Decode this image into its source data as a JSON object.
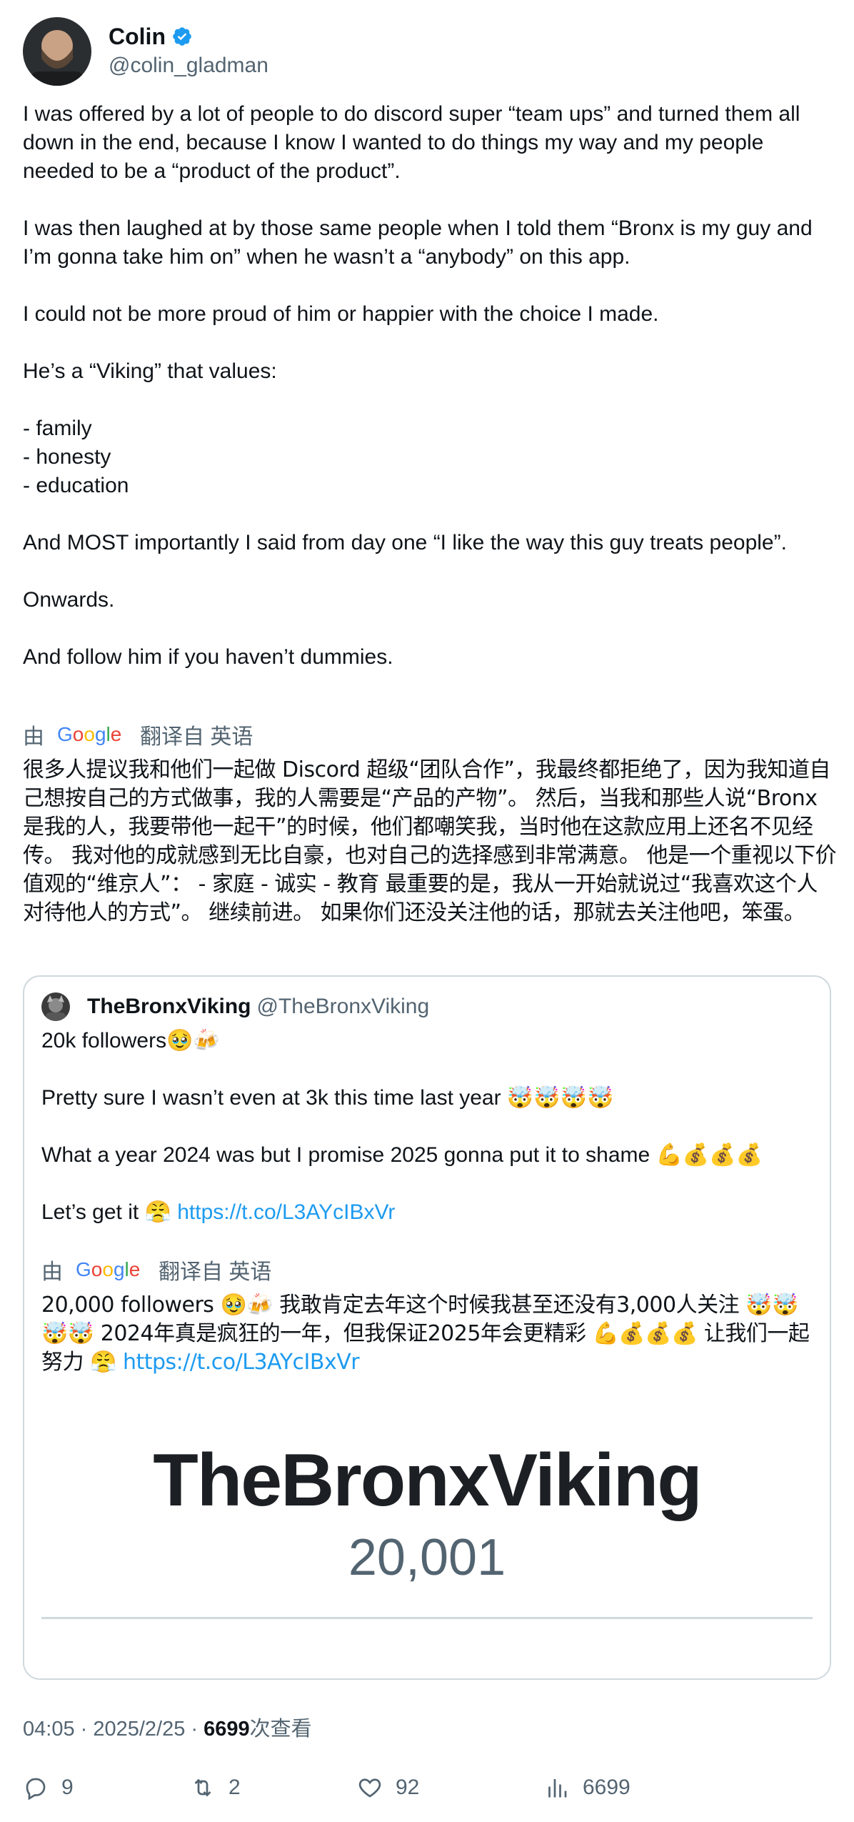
{
  "author": {
    "name": "Colin",
    "handle": "@colin_gladman"
  },
  "tweet": {
    "text": "I was offered by a lot of people to do discord super “team ups” and turned them all down in the end, because I know I wanted to do things my way and my people needed to be a “product of the product”.\n\nI was then laughed at by those same people when I told them “Bronx is my guy and I’m gonna take him on” when he wasn’t a “anybody” on this app.\n\nI could not be more proud of him or happier with the choice I made.\n\nHe’s a “Viking” that values:\n\n- family\n- honesty\n- education\n\nAnd MOST importantly I said from day one “I like the way this guy treats people”.\n\nOnwards.\n\nAnd follow him if you haven’t dummies.",
    "translation_prefix": "由",
    "translation_suffix": "翻译自 英语",
    "translated_text": "很多人提议我和他们一起做 Discord 超级“团队合作”，我最终都拒绝了，因为我知道自己想按自己的方式做事，我的人需要是“产品的产物”。 然后，当我和那些人说“Bronx 是我的人，我要带他一起干”的时候，他们都嘲笑我，当时他在这款应用上还名不见经传。 我对他的成就感到无比自豪，也对自己的选择感到非常满意。 他是一个重视以下价值观的“维京人”： - 家庭 - 诚实 - 教育 最重要的是，我从一开始就说过“我喜欢这个人对待他人的方式”。 继续前进。 如果你们还没关注他的话，那就去关注他吧，笨蛋。"
  },
  "quote": {
    "name": "TheBronxViking",
    "handle": "@TheBronxViking",
    "text_line1": "20k followers🥹🍻",
    "text_line2": "Pretty sure I wasn’t even at 3k this time last year 🤯🤯🤯🤯",
    "text_line3": "What a year 2024 was but I promise 2025 gonna put it to shame 💪💰💰💰",
    "text_line4_prefix": "Let’s get it 😤 ",
    "link": "https://t.co/L3AYcIBxVr",
    "translation_prefix": "由",
    "translation_suffix": "翻译自 英语",
    "translated_text": "20,000 followers 🥹🍻 我敢肯定去年这个时候我甚至还没有3,000人关注 🤯🤯🤯🤯 2024年真是疯狂的一年，但我保证2025年会更精彩 💪💰💰💰 让我们一起努力 😤 ",
    "media_title": "TheBronxViking",
    "media_count": "20,001"
  },
  "meta": {
    "time": "04:05 · 2025/2/25 · ",
    "views_count": "6699",
    "views_label": "次查看"
  },
  "actions": {
    "replies": "9",
    "reposts": "2",
    "likes": "92",
    "views": "6699"
  },
  "colors": {
    "link": "#1d9bf0",
    "secondary": "#536471",
    "verified": "#1d9bf0",
    "border": "#cfd9de"
  }
}
